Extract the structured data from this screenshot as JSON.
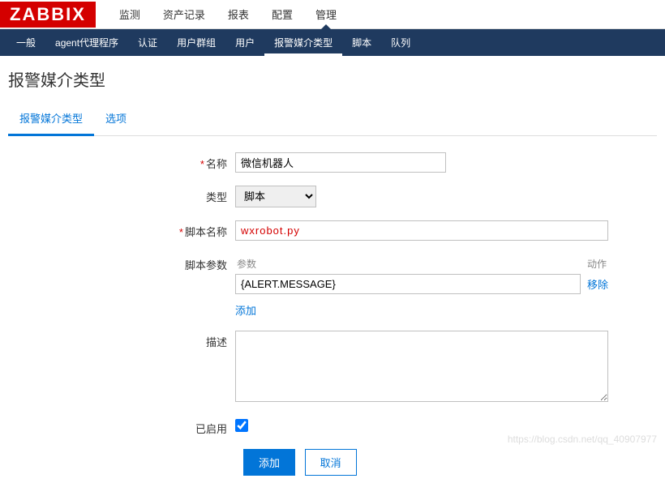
{
  "logo": "ZABBIX",
  "main_nav": {
    "items": [
      "监测",
      "资产记录",
      "报表",
      "配置",
      "管理"
    ],
    "active_index": 4
  },
  "sub_nav": {
    "items": [
      "一般",
      "agent代理程序",
      "认证",
      "用户群组",
      "用户",
      "报警媒介类型",
      "脚本",
      "队列"
    ],
    "active_index": 5
  },
  "page_title": "报警媒介类型",
  "tabs": {
    "items": [
      "报警媒介类型",
      "选项"
    ],
    "active_index": 0
  },
  "form": {
    "name_label": "名称",
    "name_value": "微信机器人",
    "type_label": "类型",
    "type_value": "脚本",
    "script_label": "脚本名称",
    "script_value": "wxrobot.py",
    "params_label": "脚本参数",
    "params_header_param": "参数",
    "params_header_action": "动作",
    "params": [
      {
        "value": "{ALERT.MESSAGE}",
        "remove": "移除"
      }
    ],
    "add_param": "添加",
    "desc_label": "描述",
    "desc_value": "",
    "enabled_label": "已启用",
    "enabled_checked": true,
    "submit": "添加",
    "cancel": "取消"
  },
  "watermark": "https://blog.csdn.net/qq_40907977"
}
